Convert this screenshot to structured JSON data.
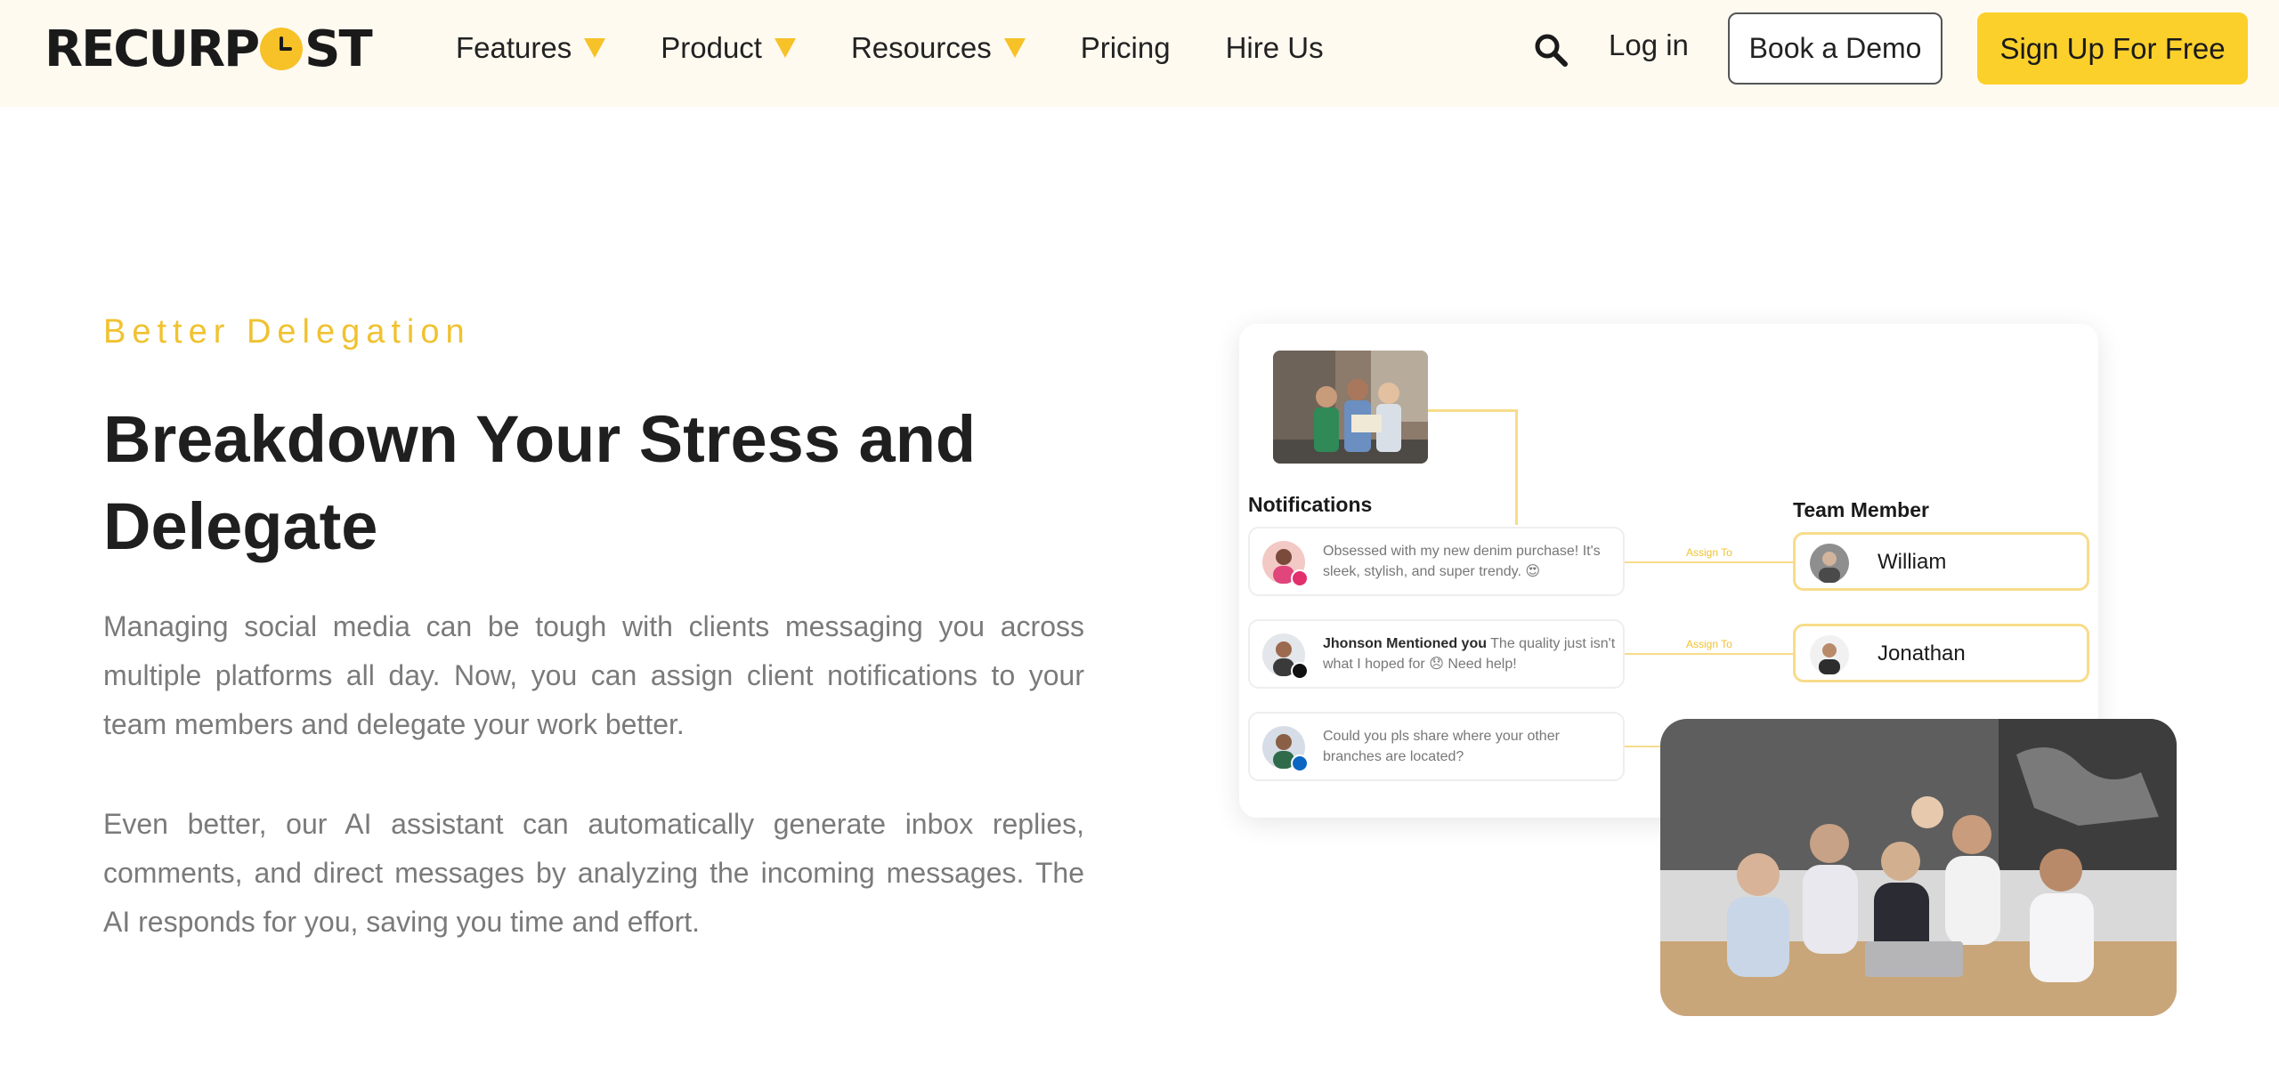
{
  "header": {
    "logo_text": "RECURPOST",
    "nav": [
      {
        "label": "Features",
        "has_dropdown": true
      },
      {
        "label": "Product",
        "has_dropdown": true
      },
      {
        "label": "Resources",
        "has_dropdown": true
      },
      {
        "label": "Pricing",
        "has_dropdown": false
      },
      {
        "label": "Hire Us",
        "has_dropdown": false
      }
    ],
    "search_icon": "search-icon",
    "login_label": "Log in",
    "demo_label": "Book a Demo",
    "signup_label": "Sign Up For Free"
  },
  "hero": {
    "eyebrow": "Better Delegation",
    "headline": "Breakdown Your Stress and Delegate",
    "paragraph1": "Managing social media can be tough with clients messaging you across multiple platforms all day. Now, you can assign client notifications to your team members and delegate your work better.",
    "paragraph2": "Even better, our AI assistant can automatically generate inbox replies, comments, and direct messages by analyzing the incoming messages. The AI responds for you, saving you time and effort."
  },
  "illustration": {
    "notifications_title": "Notifications",
    "team_title": "Team Member",
    "assign_label": "Assign To",
    "notifications": [
      {
        "bold": "",
        "text": "Obsessed with my new denim purchase! It's sleek, stylish, and super trendy. 😍",
        "platform": "instagram"
      },
      {
        "bold": "Jhonson Mentioned you",
        "text": " The quality just isn't what I hoped for 😞 Need help!",
        "platform": "x"
      },
      {
        "bold": "",
        "text": "Could you pls share where your other branches are located?",
        "platform": "linkedin"
      }
    ],
    "members": [
      {
        "name": "William"
      },
      {
        "name": "Jonathan"
      }
    ]
  },
  "colors": {
    "accent": "#fcd02b",
    "eyebrow": "#f0c230",
    "header_bg": "#fffaf0",
    "body_text": "#7a7a7a"
  }
}
